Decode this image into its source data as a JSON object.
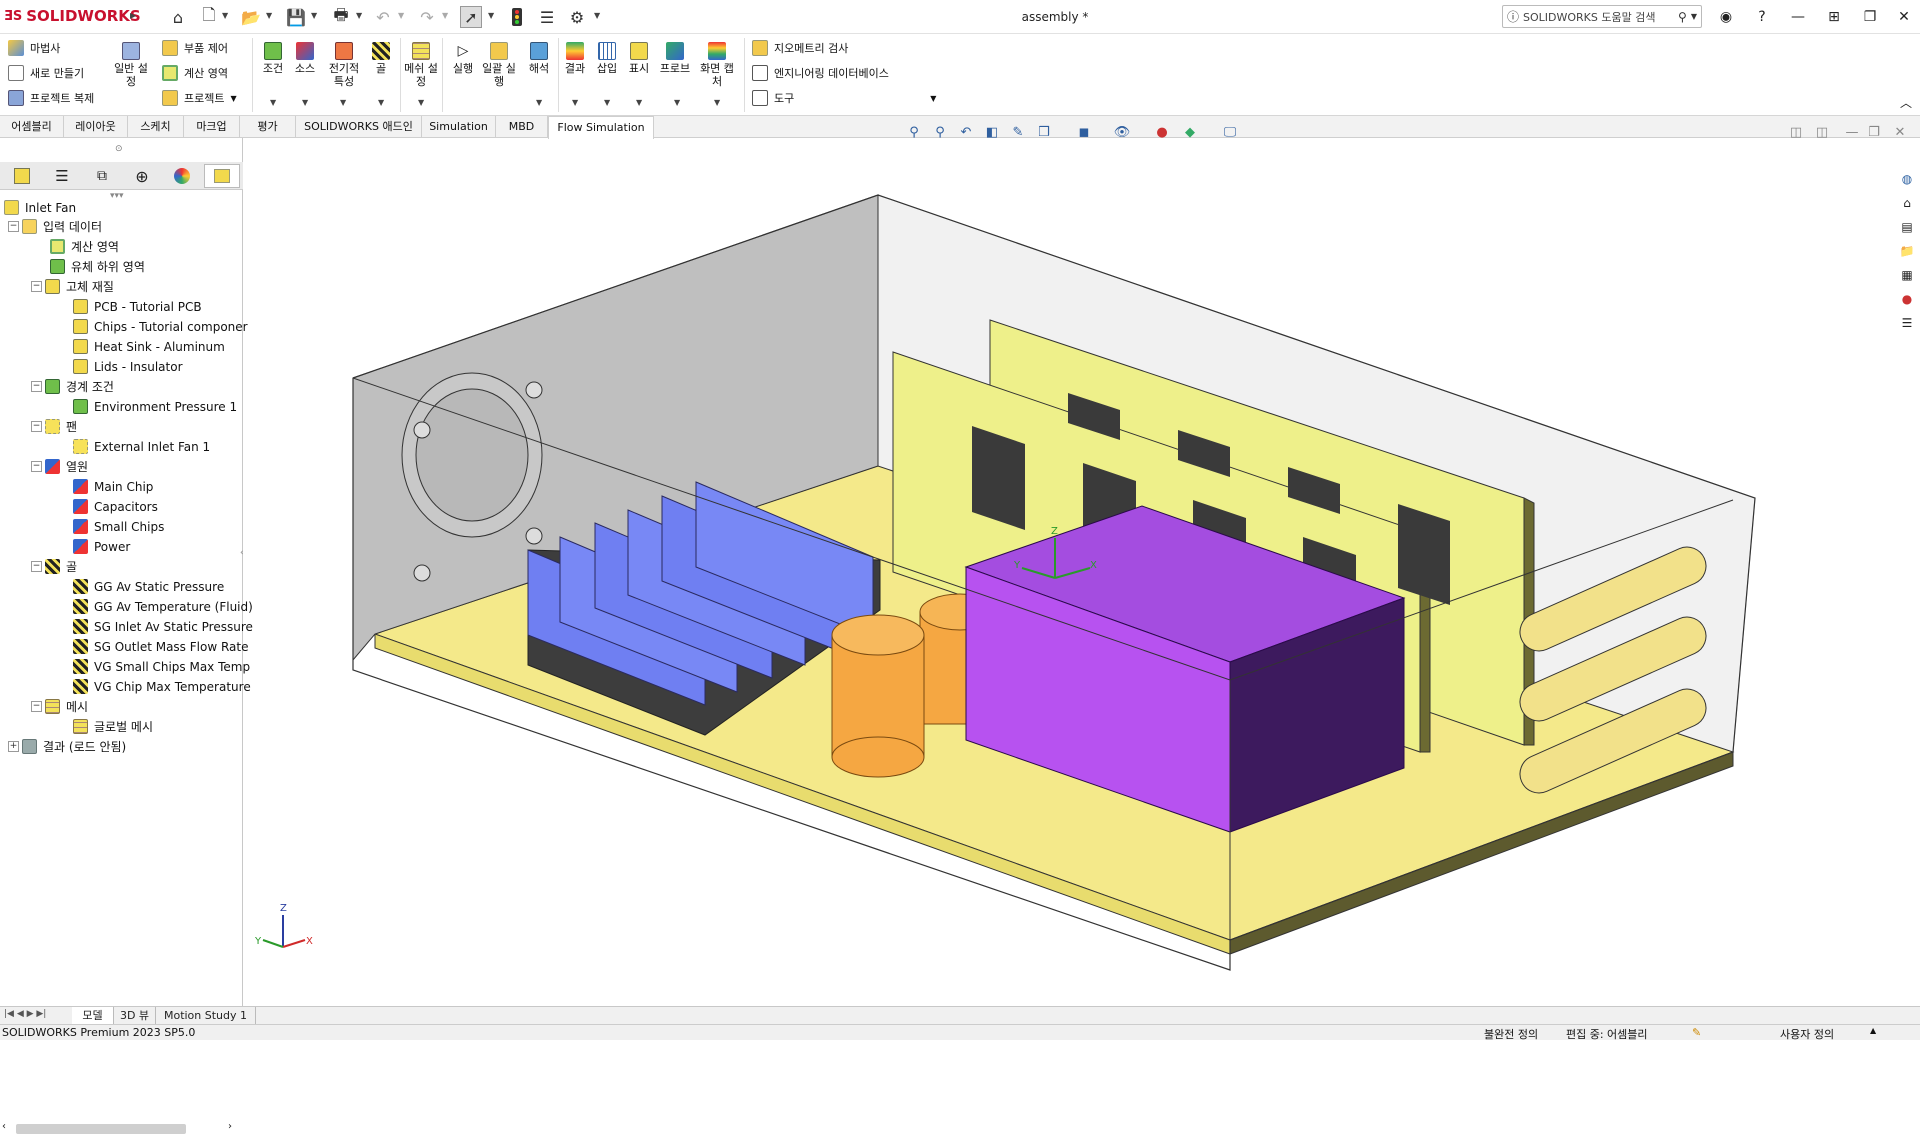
{
  "app": {
    "logo_text": "SOLIDWORKS",
    "doc_title": "assembly *",
    "search_placeholder": "SOLIDWORKS 도움말 검색"
  },
  "ribbon": {
    "wizard": "마법사",
    "new": "새로 만들기",
    "clone": "프로젝트 복제",
    "general_settings": "일반 설정",
    "component_control": "부품 제어",
    "computational_domain": "계산 영역",
    "project": "프로젝트",
    "condition": "조건",
    "source": "소스",
    "electrical": "전기적 특성",
    "goal": "골",
    "mesh_settings": "메쉬 설정",
    "run": "실행",
    "batch_run": "일괄 실행",
    "solve": "해석",
    "results": "결과",
    "insert": "삽입",
    "display": "표시",
    "probe": "프로브",
    "screen_capture": "화면 캡처",
    "geometry_check": "지오메트리 검사",
    "eng_database": "엔지니어링 데이터베이스",
    "tools": "도구"
  },
  "tabs": [
    {
      "label": "어셈블리"
    },
    {
      "label": "레이아웃"
    },
    {
      "label": "스케치"
    },
    {
      "label": "마크업"
    },
    {
      "label": "평가"
    },
    {
      "label": "SOLIDWORKS 애드인"
    },
    {
      "label": "Simulation"
    },
    {
      "label": "MBD"
    },
    {
      "label": "Flow Simulation"
    }
  ],
  "tree": {
    "root": "Inlet Fan",
    "input_data": "입력 데이터",
    "comp_domain": "계산 영역",
    "fluid_subdomain": "유체 하위 영역",
    "solid_materials": "고체 재질",
    "mat_pcb": "PCB - Tutorial PCB",
    "mat_chips": "Chips - Tutorial componer",
    "mat_heatsink": "Heat Sink - Aluminum",
    "mat_lids": "Lids - Insulator",
    "boundary_conditions": "경계 조건",
    "env_pressure": "Environment Pressure 1",
    "fans": "팬",
    "ext_inlet_fan": "External Inlet Fan 1",
    "heat_sources": "열원",
    "src_main_chip": "Main Chip",
    "src_capacitors": "Capacitors",
    "src_small_chips": "Small Chips",
    "src_power": "Power",
    "goals": "골",
    "goal_1": "GG Av Static Pressure",
    "goal_2": "GG Av Temperature (Fluid)",
    "goal_3": "SG Inlet Av Static Pressure",
    "goal_4": "SG Outlet Mass Flow Rate",
    "goal_5": "VG Small Chips Max Temp",
    "goal_6": "VG Chip Max Temperature",
    "mesh": "메시",
    "global_mesh": "글로벌 메시",
    "results": "결과 (로드 안됨)"
  },
  "bottom_tabs": [
    {
      "label": "모델"
    },
    {
      "label": "3D 뷰"
    },
    {
      "label": "Motion Study 1"
    }
  ],
  "status": {
    "product": "SOLIDWORKS Premium 2023 SP5.0",
    "under_defined": "불완전 정의",
    "editing": "편집 중: 어셈블리",
    "custom": "사용자 정의"
  },
  "triad": {
    "x": "X",
    "y": "Y",
    "z": "Z"
  },
  "colors": {
    "accent_red": "#c8102e",
    "heatsink": "#6f7ff2",
    "main_chip": "#a44de0",
    "pcb": "#f3ec9c",
    "capacitor": "#f5a742"
  }
}
